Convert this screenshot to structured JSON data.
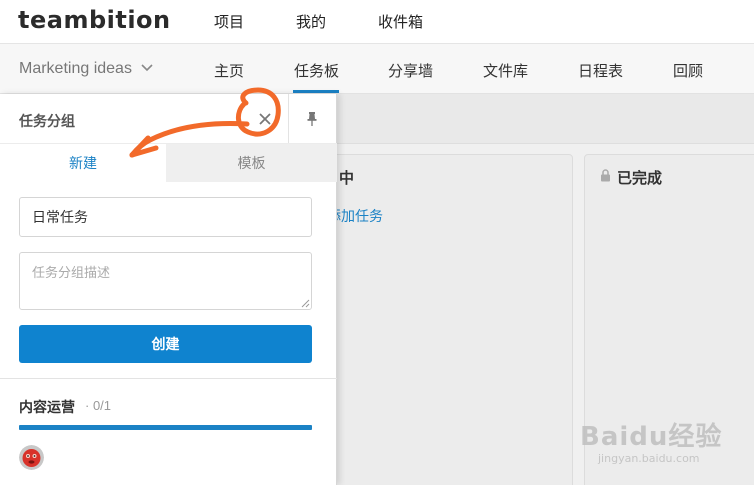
{
  "app": {
    "logo": "teambition"
  },
  "topnav": [
    {
      "label": "项目"
    },
    {
      "label": "我的"
    },
    {
      "label": "收件箱"
    }
  ],
  "project": {
    "name": "Marketing ideas",
    "tabs": [
      {
        "label": "主页"
      },
      {
        "label": "任务板"
      },
      {
        "label": "分享墙"
      },
      {
        "label": "文件库"
      },
      {
        "label": "日程表"
      },
      {
        "label": "回顾"
      }
    ],
    "active_tab": "任务板"
  },
  "board": {
    "columns": [
      {
        "title": "中",
        "add_label": "添加任务"
      },
      {
        "title": "已完成",
        "locked": true
      }
    ]
  },
  "panel": {
    "title": "任务分组",
    "tabs": {
      "new": "新建",
      "template": "模板"
    },
    "name_value": "日常任务",
    "desc_placeholder": "任务分组描述",
    "create_label": "创建",
    "group": {
      "name": "内容运营",
      "count": "· 0/1",
      "progress": 0
    }
  },
  "watermark": {
    "text": "Baidu经验",
    "sub": "jingyan.baidu.com"
  },
  "colors": {
    "accent": "#1b82c5",
    "button": "#0f83cf",
    "annotation": "#f26a2a"
  }
}
